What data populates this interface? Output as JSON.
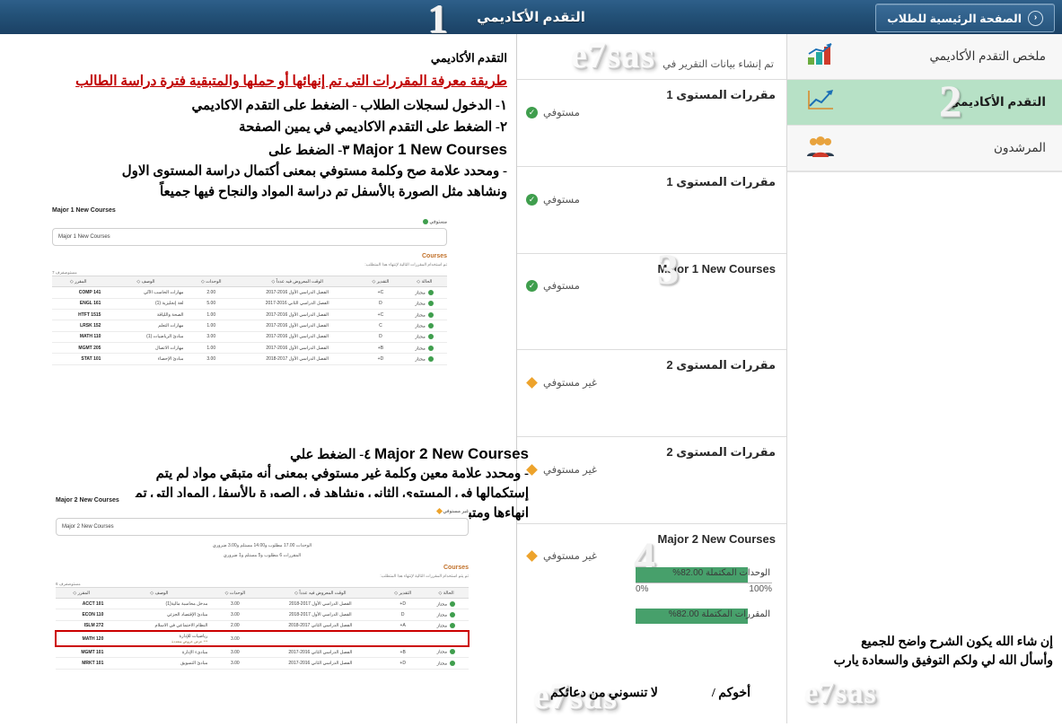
{
  "topbar": {
    "title": "التقدم الأكاديمي",
    "step_number": "1",
    "home_button": "الصفحة الرئيسية للطلاب",
    "icons": [
      "home-icon",
      "flag-icon",
      "menu-icon",
      "parenthesis-icon"
    ]
  },
  "sidebar": {
    "items": [
      {
        "label": "ملخص التقدم الأكاديمي",
        "icon": "bar-chart-icon",
        "active": false
      },
      {
        "label": "التقدم الأكاديمي",
        "icon": "line-chart-icon",
        "active": true,
        "step": "2"
      },
      {
        "label": "المرشدون",
        "icon": "people-icon",
        "active": false
      }
    ]
  },
  "report": {
    "generated_label": "تم إنشاء بيانات التقرير في",
    "requirements": [
      {
        "title": "مقررات المستوى 1",
        "status": "مستوفي",
        "state": "met"
      },
      {
        "title": "مقررات المستوى 1",
        "status": "مستوفي",
        "state": "met"
      },
      {
        "title": "Major 1 New Courses",
        "status": "مستوفي",
        "state": "met",
        "english": true,
        "step": "3"
      },
      {
        "title": "مقررات المستوى 2",
        "status": "غير مستوفي",
        "state": "unmet"
      },
      {
        "title": "مقررات المستوى 2",
        "status": "غير مستوفي",
        "state": "unmet"
      },
      {
        "title": "Major 2 New Courses",
        "status": "غير مستوفي",
        "state": "unmet",
        "english": true,
        "step": "4"
      }
    ],
    "progress": [
      {
        "label": "الوحدات المكتملة 82.00%",
        "percent": 82,
        "axis_min": "0%",
        "axis_max": "100%"
      },
      {
        "label": "المقررات المكتملة 82.00%",
        "percent": 82
      }
    ]
  },
  "left_panel": {
    "heading": "التقدم الأكاديمي",
    "subheading": "طريقة معرفة المقررات التى تم إنهائها أو حملها والمتبقية فترة دراسة الطالب",
    "steps": [
      "١- الدخول لسجلات الطلاب - الضغط على التقدم الاكاديمي",
      "٢- الضغط على التقدم الاكاديمي في يمين الصفحة"
    ],
    "step3_prefix": "٣- الضغط على",
    "step3_en": "Major 1 New Courses",
    "step3_notes": [
      "- ومحدد علامة صح وكلمة مستوفي بمعنى أكتمال دراسة المستوى الاول",
      "ونشاهد مثل الصورة بالأسفل تم دراسة المواد والنجاح فيها جميعاً"
    ],
    "step4_prefix": "٤- الضغط علي",
    "step4_en": "Major 2 New Courses",
    "step4_notes": [
      "- ومحدد علامة معين وكلمة غير مستوفي بمعنى أنه متبقي مواد لم يتم",
      "إستكمالها في المستوى الثاني ونشاهد في الصورة بالأسفل المواد التي تم",
      "انهاءها ومتبقي مادة لم يتم النجاح فيها وإستكمالها"
    ]
  },
  "shot1": {
    "title": "Major 1 New Courses",
    "status": "مستوفي",
    "box_label": "Major 1 New Courses",
    "courses_label": "Courses",
    "sub_note": "تم استخدام المقررات التالية لإنتهاء هذا المتطلب:",
    "count_label": "7 مستوصفرف",
    "columns": [
      "المقرر",
      "الوصف",
      "الوحدات",
      "الوقت المعروض فيه عدداً",
      "التقدير",
      "الحالة"
    ],
    "rows": [
      [
        "COMP 141",
        "مهارات الحاسب الآلي",
        "2.00",
        "الفصل الدراسي الأول 2016-2017",
        "C+",
        "مجتاز"
      ],
      [
        "ENGL 161",
        "لغة إنجليزية (1)",
        "5.00",
        "الفصل الدراسي الثاني 2016-2017",
        "D",
        "مجتاز"
      ],
      [
        "HTFT 1515",
        "الصحة واللياقة",
        "1.00",
        "الفصل الدراسي الأول 2016-2017",
        "C+",
        "مجتاز"
      ],
      [
        "LRSK 152",
        "مهارات التعلم",
        "1.00",
        "الفصل الدراسي الأول 2016-2017",
        "C",
        "مجتاز"
      ],
      [
        "MATH 110",
        "مبادئ الرياضيات (1)",
        "3.00",
        "الفصل الدراسي الأول 2016-2017",
        "D",
        "مجتاز"
      ],
      [
        "MGMT 205",
        "مهارات الاتصال",
        "1.00",
        "الفصل الدراسي الأول 2016-2017",
        "B+",
        "مجتاز"
      ],
      [
        "STAT 101",
        "مبادئ الإحصاء",
        "3.00",
        "الفصل الدراسي الأول 2017-2018",
        "D+",
        "مجتاز"
      ]
    ]
  },
  "shot2": {
    "title": "Major 2 New Courses",
    "status": "غير مستوفي",
    "box_label": "Major 2 New Courses",
    "units_line": "الوحدات  17.00 مطلوب و14.00 مستلم و3.00 ضروري",
    "courses_line": "المقررات  6 مطلوب و5 مستلم و1 ضروري",
    "courses_label": "Courses",
    "sub_note": "تم يتم استخدام المقررات التالية لإنتهاء هذا المتطلب:",
    "count_label": "6 مستوصفرف",
    "columns": [
      "المقرر",
      "الوصف",
      "الوحدات",
      "الوقت المعروض فيه عدداً",
      "التقدير",
      "الحالة"
    ],
    "rows": [
      [
        "ACCT 101",
        "مدخل محاسبة مالية(1)",
        "3.00",
        "الفصل الدراسي الأول 2017-2018",
        "D+",
        "مجتاز",
        ""
      ],
      [
        "ECON 110",
        "مبادئ الإقتصاد الجزئي",
        "3.00",
        "الفصل الدراسي الأول 2017-2018",
        "D",
        "مجتاز",
        ""
      ],
      [
        "ISLM 272",
        "النظام الاجتماعي في الاسلام",
        "2.00",
        "الفصل الدراسي الثاني 2017-2018",
        "A+",
        "مجتاز",
        ""
      ],
      [
        "MATH 120",
        "رياضيات للإدارة",
        "3.00",
        "",
        "",
        "",
        "highlight"
      ],
      [
        "MGMT 101",
        "مبادىء الإدارة",
        "3.00",
        "الفصل الدراسي الثاني 2016-2017",
        "B+",
        "مجتاز",
        ""
      ],
      [
        "MRKT 101",
        "مبادئ التسويق",
        "3.00",
        "الفصل الدراسي الثاني 2016-2017",
        "D+",
        "مجتاز",
        ""
      ]
    ],
    "highlight_sub": "*** عرض عروض متعددة"
  },
  "closing": {
    "lines": [
      "إن شاء الله يكون الشرح واضح للجميع",
      "وأسأل الله لي ولكم التوفيق والسعادة يارب",
      "لا تنسوني من دعائكم"
    ],
    "signature": "أخوكم /"
  },
  "watermark": {
    "text": "e7sas"
  },
  "colors": {
    "header_blue": "#235177",
    "active_green": "#b7e1c6",
    "bar_green": "#47a06b",
    "met": "#3f9e4d",
    "unmet": "#eda32b",
    "annotation_red": "#cc0000"
  }
}
